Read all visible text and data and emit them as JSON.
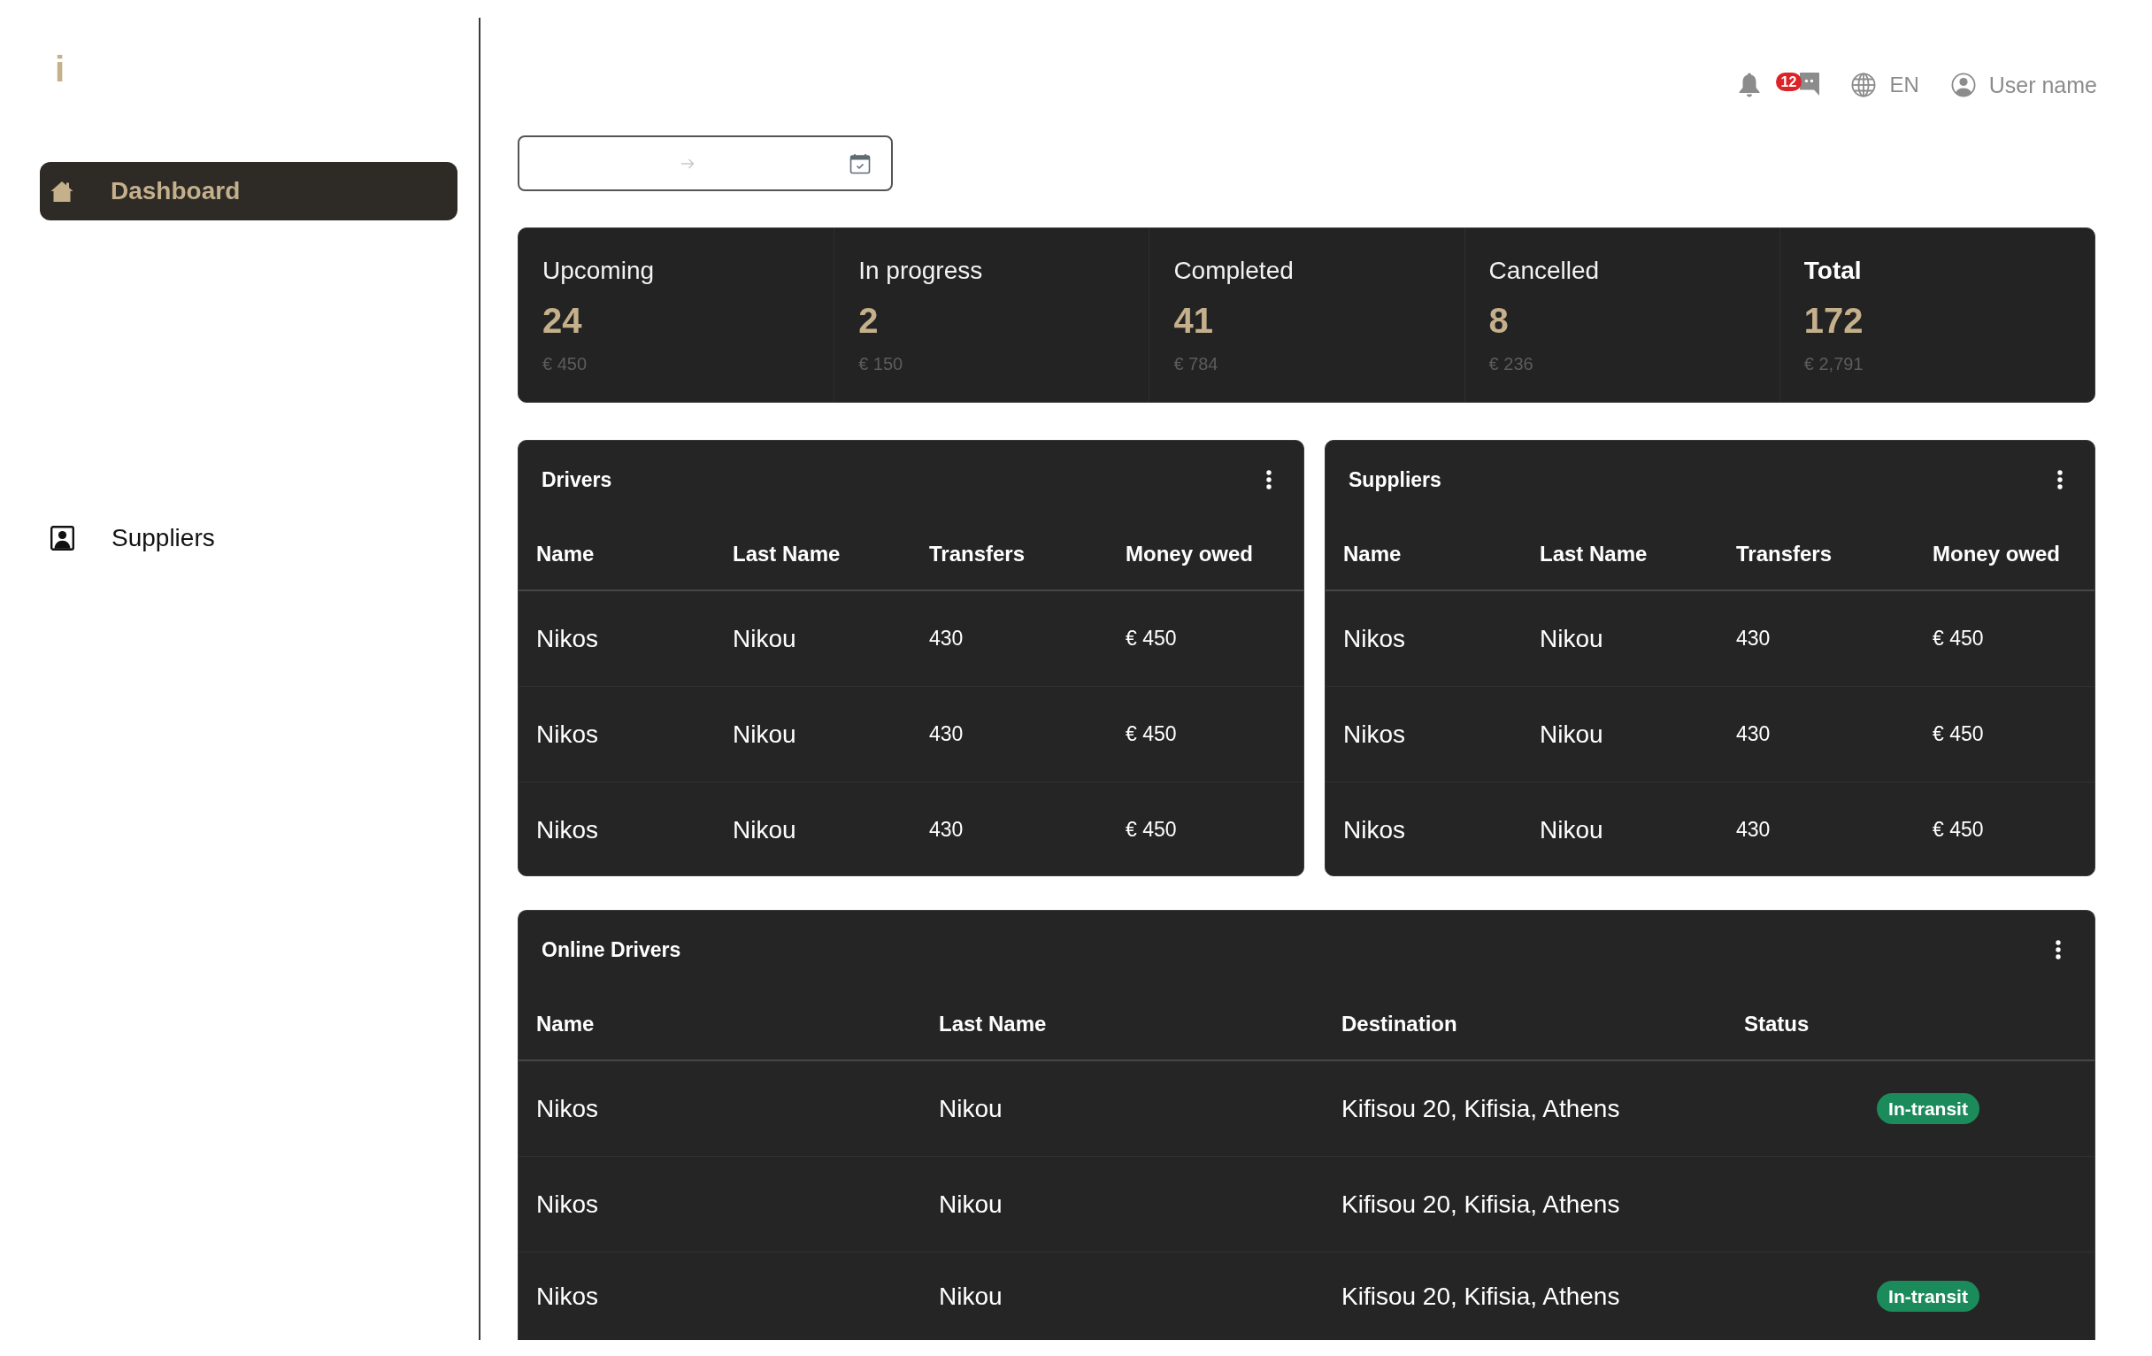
{
  "sidebar": {
    "logo": "i",
    "items": [
      {
        "label": "Dashboard",
        "selected": true
      },
      {
        "label": "Suppliers",
        "selected": false
      }
    ]
  },
  "header": {
    "notification_count": "12",
    "language": "EN",
    "user_name": "User name"
  },
  "stats": [
    {
      "kind": "status",
      "label": "Upcoming",
      "count": "24",
      "amount": "€ 450"
    },
    {
      "kind": "status",
      "label": "In progress",
      "count": "2",
      "amount": "€ 150"
    },
    {
      "kind": "status",
      "label": "Completed",
      "count": "41",
      "amount": "€ 784"
    },
    {
      "kind": "status",
      "label": "Cancelled",
      "count": "8",
      "amount": "€ 236"
    },
    {
      "kind": "total",
      "label": "Total",
      "count": "172",
      "amount": "€ 2,791"
    }
  ],
  "tables": [
    {
      "title": "Drivers",
      "columns": [
        {
          "label": "Name",
          "kind": "text"
        },
        {
          "label": "Last Name",
          "kind": "text"
        },
        {
          "label": "Transfers",
          "kind": "number"
        },
        {
          "label": "Money owed",
          "kind": "number"
        }
      ],
      "rows": [
        [
          "Nikos",
          "Nikou",
          "430",
          "€ 450"
        ],
        [
          "Nikos",
          "Nikou",
          "430",
          "€ 450"
        ],
        [
          "Nikos",
          "Nikou",
          "430",
          "€ 450"
        ]
      ]
    },
    {
      "title": "Suppliers",
      "columns": [
        {
          "label": "Name",
          "kind": "text"
        },
        {
          "label": "Last Name",
          "kind": "text"
        },
        {
          "label": "Transfers",
          "kind": "number"
        },
        {
          "label": "Money owed",
          "kind": "number"
        }
      ],
      "rows": [
        [
          "Nikos",
          "Nikou",
          "430",
          "€ 450"
        ],
        [
          "Nikos",
          "Nikou",
          "430",
          "€ 450"
        ],
        [
          "Nikos",
          "Nikou",
          "430",
          "€ 450"
        ]
      ]
    }
  ],
  "online_drivers": {
    "title": "Online Drivers",
    "columns": [
      {
        "label": "Name",
        "kind": "text"
      },
      {
        "label": "Last Name",
        "kind": "text"
      },
      {
        "label": "Destination",
        "kind": "text"
      },
      {
        "label": "Status",
        "kind": "badge"
      }
    ],
    "rows": [
      [
        "Nikos",
        "Nikou",
        "Kifisou 20, Kifisia, Athens",
        "In-transit"
      ],
      [
        "Nikos",
        "Nikou",
        "Kifisou 20, Kifisia, Athens"
      ],
      [
        "Nikos",
        "Nikou",
        "Kifisou 20, Kifisia, Athens",
        "In-transit"
      ]
    ]
  }
}
